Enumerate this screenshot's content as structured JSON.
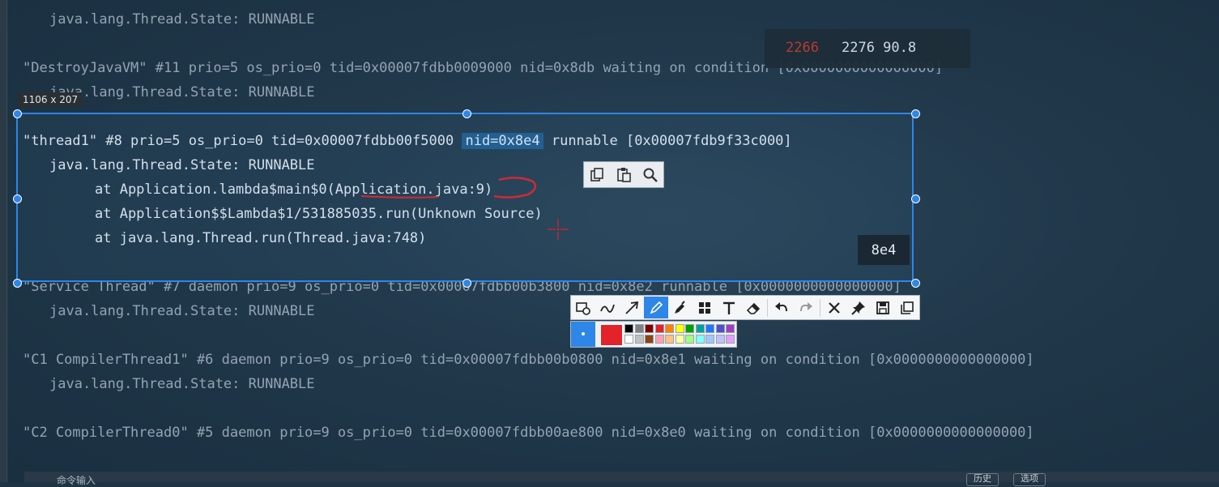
{
  "terminal": {
    "lines": [
      "java.lang.Thread.State: RUNNABLE",
      "\"DestroyJavaVM\" #11 prio=5 os_prio=0 tid=0x00007fdbb0009000 nid=0x8db waiting on condition [0x0000000000000000]",
      "java.lang.Thread.State: RUNNABLE",
      "\"thread1\" #8 prio=5 os_prio=0 tid=0x00007fdbb00f5000",
      "nid=0x8e4",
      "runnable [0x00007fdb9f33c000]",
      "java.lang.Thread.State: RUNNABLE",
      "at Application.lambda$main$0(Application.java:9)",
      "at Application$$Lambda$1/531885035.run(Unknown Source)",
      "at java.lang.Thread.run(Thread.java:748)",
      "\"Service Thread\" #7 daemon prio=9 os_prio=0 tid=0x00007fdbb00b3800 nid=0x8e2 runnable [0x0000000000000000]",
      "java.lang.Thread.State: RUNNABLE",
      "\"C1 CompilerThread1\" #6 daemon prio=9 os_prio=0 tid=0x00007fdbb00b0800 nid=0x8e1 waiting on condition [0x0000000000000000]",
      "java.lang.Thread.State: RUNNABLE",
      "\"C2 CompilerThread0\" #5 daemon prio=9 os_prio=0 tid=0x00007fdbb00ae800 nid=0x8e0 waiting on condition [0x0000000000000000]"
    ]
  },
  "overlay": {
    "perf_pid": "2266",
    "perf_values": "2276 90.8",
    "selection_size": "1106 x 207",
    "hover_badge": "8e4"
  },
  "annotation": {
    "selected_color": "#e3222a",
    "palette": [
      "#000000",
      "#808080",
      "#800000",
      "#e3222a",
      "#ff8000",
      "#ffff00",
      "#00a000",
      "#00a0a0",
      "#1e78ff",
      "#5050c8",
      "#a040c0",
      "#ffffff",
      "#c0c0c0",
      "#8b4513",
      "#ff9fb0",
      "#ffc080",
      "#ffffa0",
      "#a0ff80",
      "#80ffff",
      "#a0c8ff",
      "#c0c0ff",
      "#e0a0ff"
    ]
  },
  "status_bar": {
    "input_placeholder": "命令输入",
    "history_label": "历史",
    "options_label": "选项"
  },
  "icons": {
    "mini_toolbar": [
      "copy-icon",
      "paste-icon",
      "search-icon"
    ],
    "main_toolbar": [
      "shape-icon",
      "curve-icon",
      "arrow-icon",
      "pen-icon",
      "marker-icon",
      "mosaic-icon",
      "text-icon",
      "eraser-icon",
      "undo-icon",
      "redo-icon",
      "close-icon",
      "pin-icon",
      "save-icon",
      "copy-icon"
    ]
  }
}
